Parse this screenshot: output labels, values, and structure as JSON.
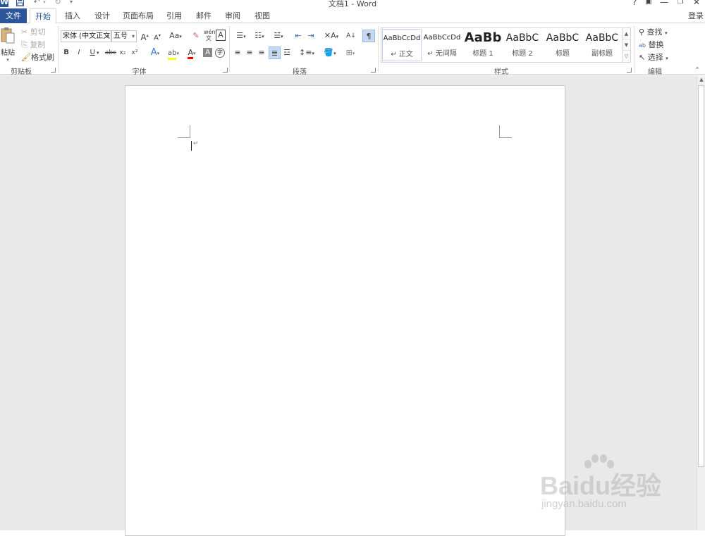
{
  "window": {
    "title": "文档1 - Word",
    "help": "?",
    "restore_ribbon": "▣",
    "minimize": "—",
    "maximize": "❐",
    "close": "✕"
  },
  "qat": {
    "app_icon": "W",
    "save_icon": "save-icon",
    "undo_icon": "undo-icon",
    "redo_icon": "redo-icon",
    "customize_icon": "customize-qat-icon"
  },
  "tabs": [
    {
      "label": "文件"
    },
    {
      "label": "开始"
    },
    {
      "label": "插入"
    },
    {
      "label": "设计"
    },
    {
      "label": "页面布局"
    },
    {
      "label": "引用"
    },
    {
      "label": "邮件"
    },
    {
      "label": "审阅"
    },
    {
      "label": "视图"
    }
  ],
  "login": "登录",
  "clipboard": {
    "paste": "粘贴",
    "cut": "剪切",
    "copy": "复制",
    "format_painter": "格式刷",
    "group_label": "剪贴板"
  },
  "font": {
    "font_name": "宋体 (中文正文",
    "font_size": "五号",
    "grow": "A",
    "shrink": "A",
    "change_case": "Aa",
    "bold": "B",
    "italic": "I",
    "underline": "U",
    "strikethrough": "abc",
    "subscript": "x₂",
    "superscript": "x²",
    "group_label": "字体"
  },
  "paragraph": {
    "group_label": "段落"
  },
  "styles": {
    "items": [
      {
        "preview": "AaBbCcDd",
        "name": "↵ 正文"
      },
      {
        "preview": "AaBbCcDd",
        "name": "↵ 无间隔"
      },
      {
        "preview": "AaBb",
        "name": "标题 1"
      },
      {
        "preview": "AaBbC",
        "name": "标题 2"
      },
      {
        "preview": "AaBbC",
        "name": "标题"
      },
      {
        "preview": "AaBbC",
        "name": "副标题"
      }
    ],
    "group_label": "样式"
  },
  "editing": {
    "find": "查找",
    "replace": "替换",
    "select": "选择",
    "group_label": "编辑"
  },
  "document": {
    "paragraph_mark": "↵"
  },
  "watermark": {
    "logo": "Baidu经验",
    "url": "jingyan.baidu.com"
  },
  "colors": {
    "accent": "#2b579a",
    "highlight": "#ffff00",
    "font_color": "#ff0000"
  }
}
